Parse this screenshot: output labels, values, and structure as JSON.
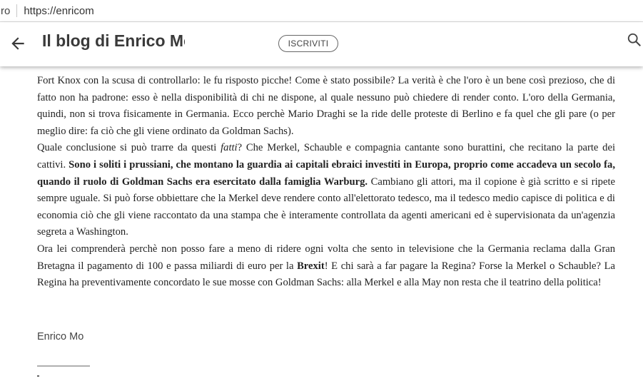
{
  "browser": {
    "tab_fragment": "ro",
    "url": "https://enricom"
  },
  "header": {
    "title": "Il blog di Enrico Mo",
    "subscribe_label": "ISCRIVITI"
  },
  "article": {
    "p1": "Fort Knox con la scusa di controllarlo: le fu risposto picche! Come è stato possibile? La verità è che l'oro è un bene così prezioso, che di fatto non ha padrone: esso è nella disponibilità di chi ne dispone, al quale nessuno può chiedere di render conto. L'oro della Germania, quindi, non si trova fisicamente in Germania. Ecco perchè Mario Draghi se la ride delle proteste di Berlino e fa quel che gli pare (o per meglio dire: fa ciò che gli viene ordinato da Goldman Sachs).",
    "p2_a": "Quale conclusione si può trarre da questi ",
    "p2_italic": "fatti",
    "p2_b": "? Che Merkel, Schauble e compagnia cantante sono burattini, che recitano la parte dei cattivi. ",
    "p2_bold": "Sono i soliti i prussiani, che montano la guardia ai capitali ebraici investiti in Europa, proprio come accadeva un secolo fa, quando il ruolo di Goldman Sachs era esercitato dalla famiglia Warburg.",
    "p2_c": " Cambiano gli attori, ma il copione è già scritto e si ripete sempre uguale. Si può forse obbiettare che la Merkel deve rendere conto all'elettorato tedesco, ma il tedesco medio capisce di politica e di economia ciò che gli viene raccontato da una stampa che è interamente controllata da agenti americani ed è supervisionata da un'agenzia segreta a Washington.",
    "p3_a": "Ora lei comprenderà perchè non posso fare a meno di ridere ogni volta che sento in televisione che la Germania reclama dalla Gran Bretagna il pagamento di 100 e passa miliardi di euro per la ",
    "p3_bold": "Brexit",
    "p3_b": "! E chi sarà a far pagare la Regina? Forse la Merkel o Schauble? La Regina ha preventivamente concordato le sue mosse con Goldman Sachs: alla Merkel e alla May non resta che il teatrino della politica!",
    "signature": "Enrico Mo"
  },
  "icons": {
    "back": "arrow-left-icon",
    "search": "search-icon"
  },
  "colors": {
    "header_text": "#3a3a3a",
    "body_text": "#222222",
    "background": "#ffffff"
  }
}
